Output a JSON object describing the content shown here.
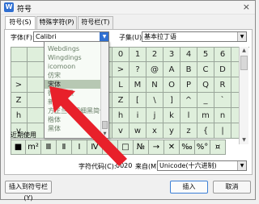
{
  "window": {
    "title": "符号",
    "app_icon": "W",
    "close": "×"
  },
  "tabs": [
    {
      "label": "符号(S)"
    },
    {
      "label": "特殊字符(P)"
    },
    {
      "label": "符号栏(T)"
    }
  ],
  "font": {
    "label": "字体(F):",
    "value": "Calibri",
    "arrow": "▼"
  },
  "subset": {
    "label": "子集(U):",
    "value": "基本拉丁语",
    "arrow": "▼"
  },
  "font_dropdown": {
    "items": [
      "Webdings",
      "Wingdings",
      "icomoon",
      "仿宋",
      "宋体",
      "微软雅黑",
      "新宋体",
      "方正兰亭超细黑简体",
      "楷体",
      "黑体"
    ],
    "selected_index": 4
  },
  "symbol_grid": {
    "rows": [
      [
        "",
        "",
        "",
        "",
        "",
        "/",
        "0",
        "1",
        "2",
        "3",
        "4",
        "5",
        "6",
        ""
      ],
      [
        "",
        "",
        "",
        "",
        "",
        "=",
        ">",
        "?",
        "@",
        "A",
        "B",
        "C",
        "D",
        ""
      ],
      [
        ">",
        "",
        "",
        "",
        "",
        "K",
        "L",
        "M",
        "N",
        "O",
        "P",
        "Q",
        "R",
        ""
      ],
      [
        "Z",
        "",
        "",
        "",
        "",
        "Y",
        "Z",
        "[",
        "\\",
        "]",
        "^",
        "_",
        "`",
        ""
      ],
      [
        "h",
        "",
        "",
        "",
        "",
        "g",
        "h",
        "i",
        "j",
        "k",
        "l",
        "m",
        "n",
        ""
      ],
      [
        "v",
        "",
        "",
        "",
        "",
        "u",
        "v",
        "w",
        "x",
        "y",
        "z",
        "{",
        "|",
        ""
      ]
    ]
  },
  "recent": {
    "label": "近期使用",
    "symbols": [
      "■",
      "m²",
      "Ⅲ",
      "Ⅱ",
      "Ⅰ",
      "Ⅳ",
      "℡",
      "□",
      "№",
      "→",
      "✕",
      "‰",
      "%°",
      "¤"
    ]
  },
  "code": {
    "label": "字符代码(C):",
    "value": "0020",
    "from_label": "来自(M):",
    "from_value": "Unicode(十六进制)",
    "arrow": "▼"
  },
  "buttons": {
    "insert_to_bar": "插入到符号栏(Y)",
    "insert": "插入",
    "cancel": "取消"
  },
  "scroll": {
    "up": "▲",
    "down": "▼"
  },
  "colors": {
    "grid_bg": "#dfefdc",
    "accent": "#2f6fd1",
    "arrow_red": "#e8202a"
  }
}
